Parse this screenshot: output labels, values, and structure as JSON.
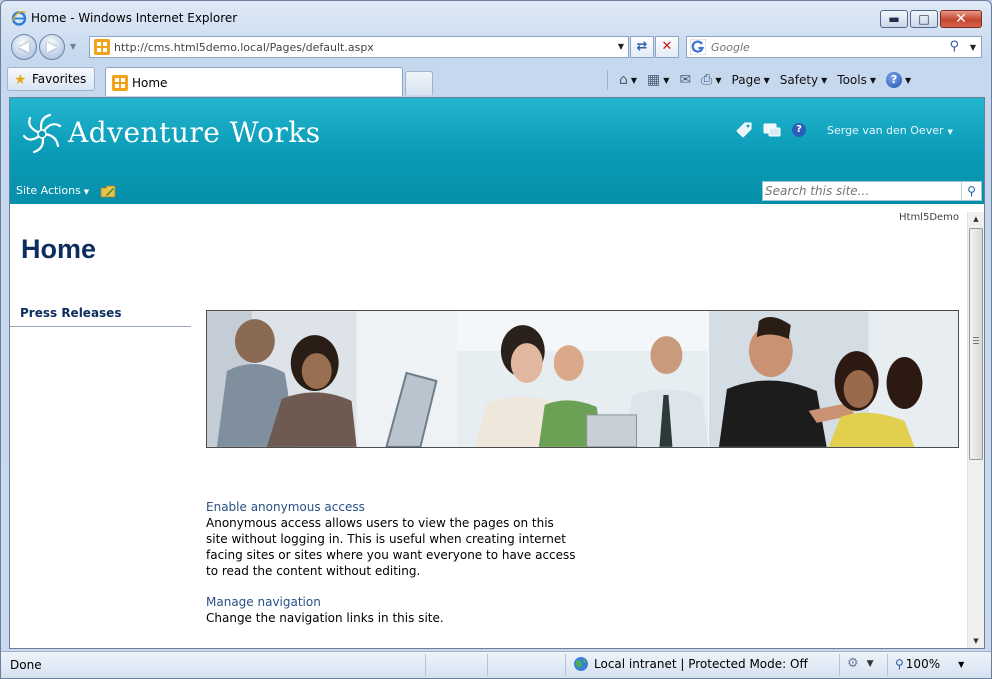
{
  "window": {
    "title": "Home - Windows Internet Explorer"
  },
  "address": {
    "url": "http://cms.html5demo.local/Pages/default.aspx"
  },
  "search": {
    "placeholder": "Google"
  },
  "favorites": {
    "label": "Favorites"
  },
  "tabs": [
    {
      "label": "Home"
    }
  ],
  "commandbar": {
    "page": "Page",
    "safety": "Safety",
    "tools": "Tools"
  },
  "site": {
    "brand": "Adventure Works",
    "user": "Serge van den Oever",
    "site_actions": "Site Actions",
    "search_placeholder": "Search this site...",
    "site_name": "Html5Demo",
    "page_title": "Home",
    "quicklaunch_heading": "Press Releases",
    "links": [
      {
        "title": "Enable anonymous access",
        "description": "Anonymous access allows users to view the pages on this site without logging in. This is useful when creating internet facing sites or sites where you want everyone to have access to read the content without editing."
      },
      {
        "title": "Manage navigation",
        "description": "Change the navigation links in this site."
      }
    ]
  },
  "status": {
    "text": "Done",
    "zone": "Local intranet | Protected Mode: Off",
    "zoom": "100%"
  },
  "colors": {
    "banner": "#0a9cb8",
    "title_blue": "#0c2d5e",
    "link_blue": "#2a4f86"
  }
}
